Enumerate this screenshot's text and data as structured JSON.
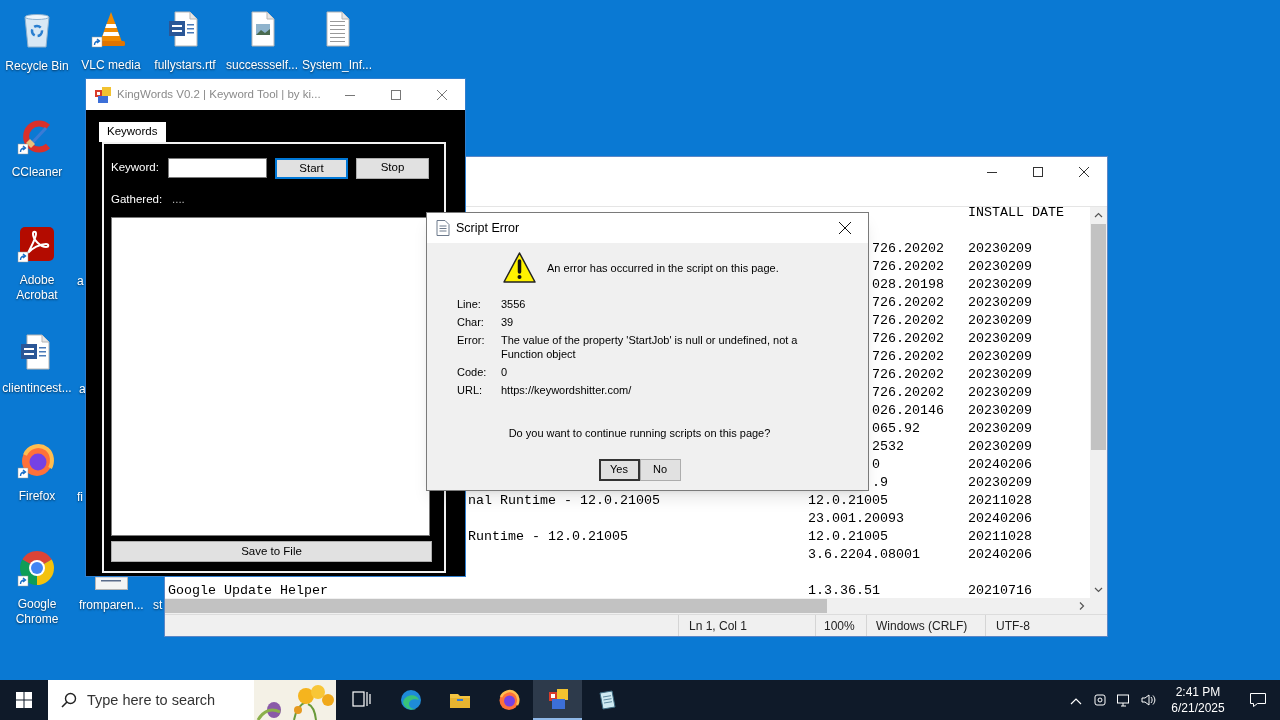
{
  "desktop": {
    "icons": [
      {
        "kind": "recycle_bin",
        "label": "Recycle Bin",
        "shortcut": false
      },
      {
        "kind": "vlc",
        "label": "VLC media",
        "shortcut": true
      },
      {
        "kind": "word_doc",
        "label": "fullystars.rtf",
        "shortcut": false
      },
      {
        "kind": "image_doc",
        "label": "successself...",
        "shortcut": false
      },
      {
        "kind": "text_doc",
        "label": "System_Inf...",
        "shortcut": false
      },
      {
        "kind": "ccleaner",
        "label": "CCleaner",
        "shortcut": true
      },
      {
        "kind": "acrobat",
        "label": "Adobe Acrobat",
        "shortcut": true
      },
      {
        "kind": "word_doc",
        "label": "clientincest...",
        "shortcut": false
      },
      {
        "kind": "firefox",
        "label": "Firefox",
        "shortcut": true
      },
      {
        "kind": "chrome",
        "label": "Google Chrome",
        "shortcut": true
      }
    ],
    "partly_hidden_labels": [
      "a",
      "a",
      "fi",
      "fromparen...",
      "st"
    ]
  },
  "notepad": {
    "rows": [
      {
        "kind": "plain",
        "date": "INSTALL DATE"
      },
      {
        "kind": "blank"
      },
      {
        "kind": "covered_version",
        "version": "726.20202",
        "date": "20230209"
      },
      {
        "kind": "covered_version",
        "version": "726.20202",
        "date": "20230209"
      },
      {
        "kind": "covered_version",
        "version": "028.20198",
        "date": "20230209"
      },
      {
        "kind": "covered_version",
        "version": "726.20202",
        "date": "20230209"
      },
      {
        "kind": "covered_version",
        "version": "726.20202",
        "date": "20230209"
      },
      {
        "kind": "covered_version",
        "version": "726.20202",
        "date": "20230209"
      },
      {
        "kind": "covered_version",
        "version": "726.20202",
        "date": "20230209"
      },
      {
        "kind": "covered_version",
        "version": "726.20202",
        "date": "20230209"
      },
      {
        "kind": "covered_version",
        "version": "726.20202",
        "date": "20230209"
      },
      {
        "kind": "covered_version",
        "version": "026.20146",
        "date": "20230209"
      },
      {
        "kind": "covered_version",
        "version": "065.92",
        "date": "20230209"
      },
      {
        "kind": "covered_version",
        "version": "2532",
        "date": "20230209"
      },
      {
        "kind": "covered_version",
        "version": "0",
        "date": "20240206"
      },
      {
        "kind": "covered_version",
        "version": ".9",
        "date": "20230209"
      },
      {
        "kind": "covered_name",
        "name": "nal Runtime - 12.0.21005",
        "version": "12.0.21005",
        "date": "20211028"
      },
      {
        "kind": "plain",
        "version": "23.001.20093",
        "date": "20240206"
      },
      {
        "kind": "covered_name",
        "name": "Runtime - 12.0.21005",
        "version": "12.0.21005",
        "date": "20211028"
      },
      {
        "kind": "plain",
        "version": "3.6.2204.08001",
        "date": "20240206"
      },
      {
        "kind": "blank"
      },
      {
        "kind": "plain",
        "name": "Google Update Helper",
        "version": "1.3.36.51",
        "date": "20210716"
      }
    ],
    "status_bar": [
      "Ln 1, Col 1",
      "100%",
      "Windows (CRLF)",
      "UTF-8"
    ]
  },
  "kingwords": {
    "title": "KingWords V0.2 | Keyword Tool | by ki...",
    "tabs": [
      {
        "label": "Keywords",
        "selected": true
      }
    ],
    "keyword_label": "Keyword:",
    "buttons": [
      {
        "label": "Start",
        "focused": true
      },
      {
        "label": "Stop",
        "focused": false
      }
    ],
    "gathered_label": "Gathered:",
    "gathered_value": "....",
    "save_button": "Save to File"
  },
  "script_error": {
    "title": "Script Error",
    "message": "An error has occurred in the script on this page.",
    "details": [
      {
        "label": "Line:",
        "value": "3556"
      },
      {
        "label": "Char:",
        "value": "39"
      },
      {
        "label": "Error:",
        "value": "The value of the property 'StartJob' is null or undefined, not a Function object"
      },
      {
        "label": "Code:",
        "value": "0"
      },
      {
        "label": "URL:",
        "value": "https://keywordshitter.com/"
      }
    ],
    "question": "Do you want to continue running scripts on this page?",
    "buttons": [
      {
        "label": "Yes",
        "default": true
      },
      {
        "label": "No",
        "default": false
      }
    ]
  },
  "taskbar": {
    "search": {
      "placeholder": "Type here to search"
    },
    "apps": [
      {
        "kind": "task_view",
        "active": false
      },
      {
        "kind": "edge",
        "active": false
      },
      {
        "kind": "explorer",
        "active": false
      },
      {
        "kind": "firefox",
        "active": false
      },
      {
        "kind": "kingwords",
        "active": true
      },
      {
        "kind": "notepad",
        "active": false
      }
    ],
    "time": "2:41 PM",
    "date": "6/21/2025"
  }
}
